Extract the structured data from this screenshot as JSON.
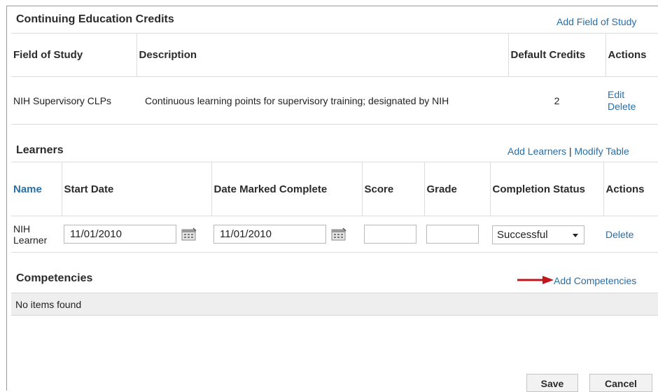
{
  "ce": {
    "title": "Continuing Education Credits",
    "add_link": "Add Field of Study",
    "headers": [
      "Field of Study",
      "Description",
      "Default Credits",
      "Actions"
    ],
    "row": {
      "field": "NIH Supervisory CLPs",
      "description": "Continuous learning points for supervisory training; designated by NIH",
      "credits": "2",
      "edit": "Edit",
      "delete": "Delete"
    }
  },
  "learners": {
    "title": "Learners",
    "add_link": "Add Learners",
    "separator": "|",
    "modify_link": "Modify Table",
    "headers": [
      "Name",
      "Start Date",
      "Date Marked Complete",
      "Score",
      "Grade",
      "Completion Status",
      "Actions"
    ],
    "row": {
      "name": "NIH Learner",
      "start_date": "11/01/2010",
      "complete_date": "11/01/2010",
      "score": "",
      "grade": "",
      "status": "Successful",
      "delete": "Delete"
    }
  },
  "competencies": {
    "title": "Competencies",
    "add_link": "Add Competencies",
    "empty": "No items found"
  },
  "buttons": {
    "save": "Save",
    "cancel": "Cancel"
  },
  "colors": {
    "link": "#2a6ea6",
    "arrow": "#c0161c"
  }
}
